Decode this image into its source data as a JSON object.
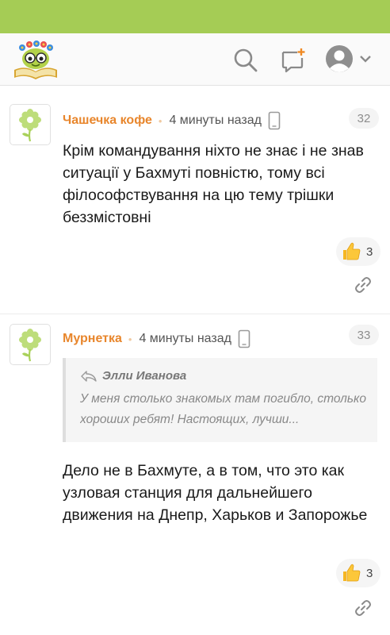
{
  "app": {
    "brand_color": "#a5cc55",
    "accent_color": "#e8862c"
  },
  "header": {
    "icons": [
      "logo-icon",
      "search-icon",
      "new-post-icon",
      "user-avatar-icon",
      "chevron-down-icon"
    ]
  },
  "comments": [
    {
      "author": "Чашечка кофе",
      "separator": "•",
      "time": "4 минуты назад",
      "device": "mobile",
      "number": "32",
      "text": "Крім командування ніхто не знає і не знав ситуації у Бахмуті повністю, тому всі філософствування на цю тему трішки беззмістовні",
      "likes": "3"
    },
    {
      "author": "Мурнетка",
      "separator": "•",
      "time": "4 минуты назад",
      "device": "mobile",
      "number": "33",
      "quote": {
        "author": "Элли Иванова",
        "text": "У меня столько знакомых там погибло, столько хороших ребят! Настоящих, лучши..."
      },
      "text": "Дело не в Бахмуте, а в том, что это как узловая станция для дальнейшего движения на Днепр, Харьков и Запорожье",
      "likes": "3"
    }
  ]
}
